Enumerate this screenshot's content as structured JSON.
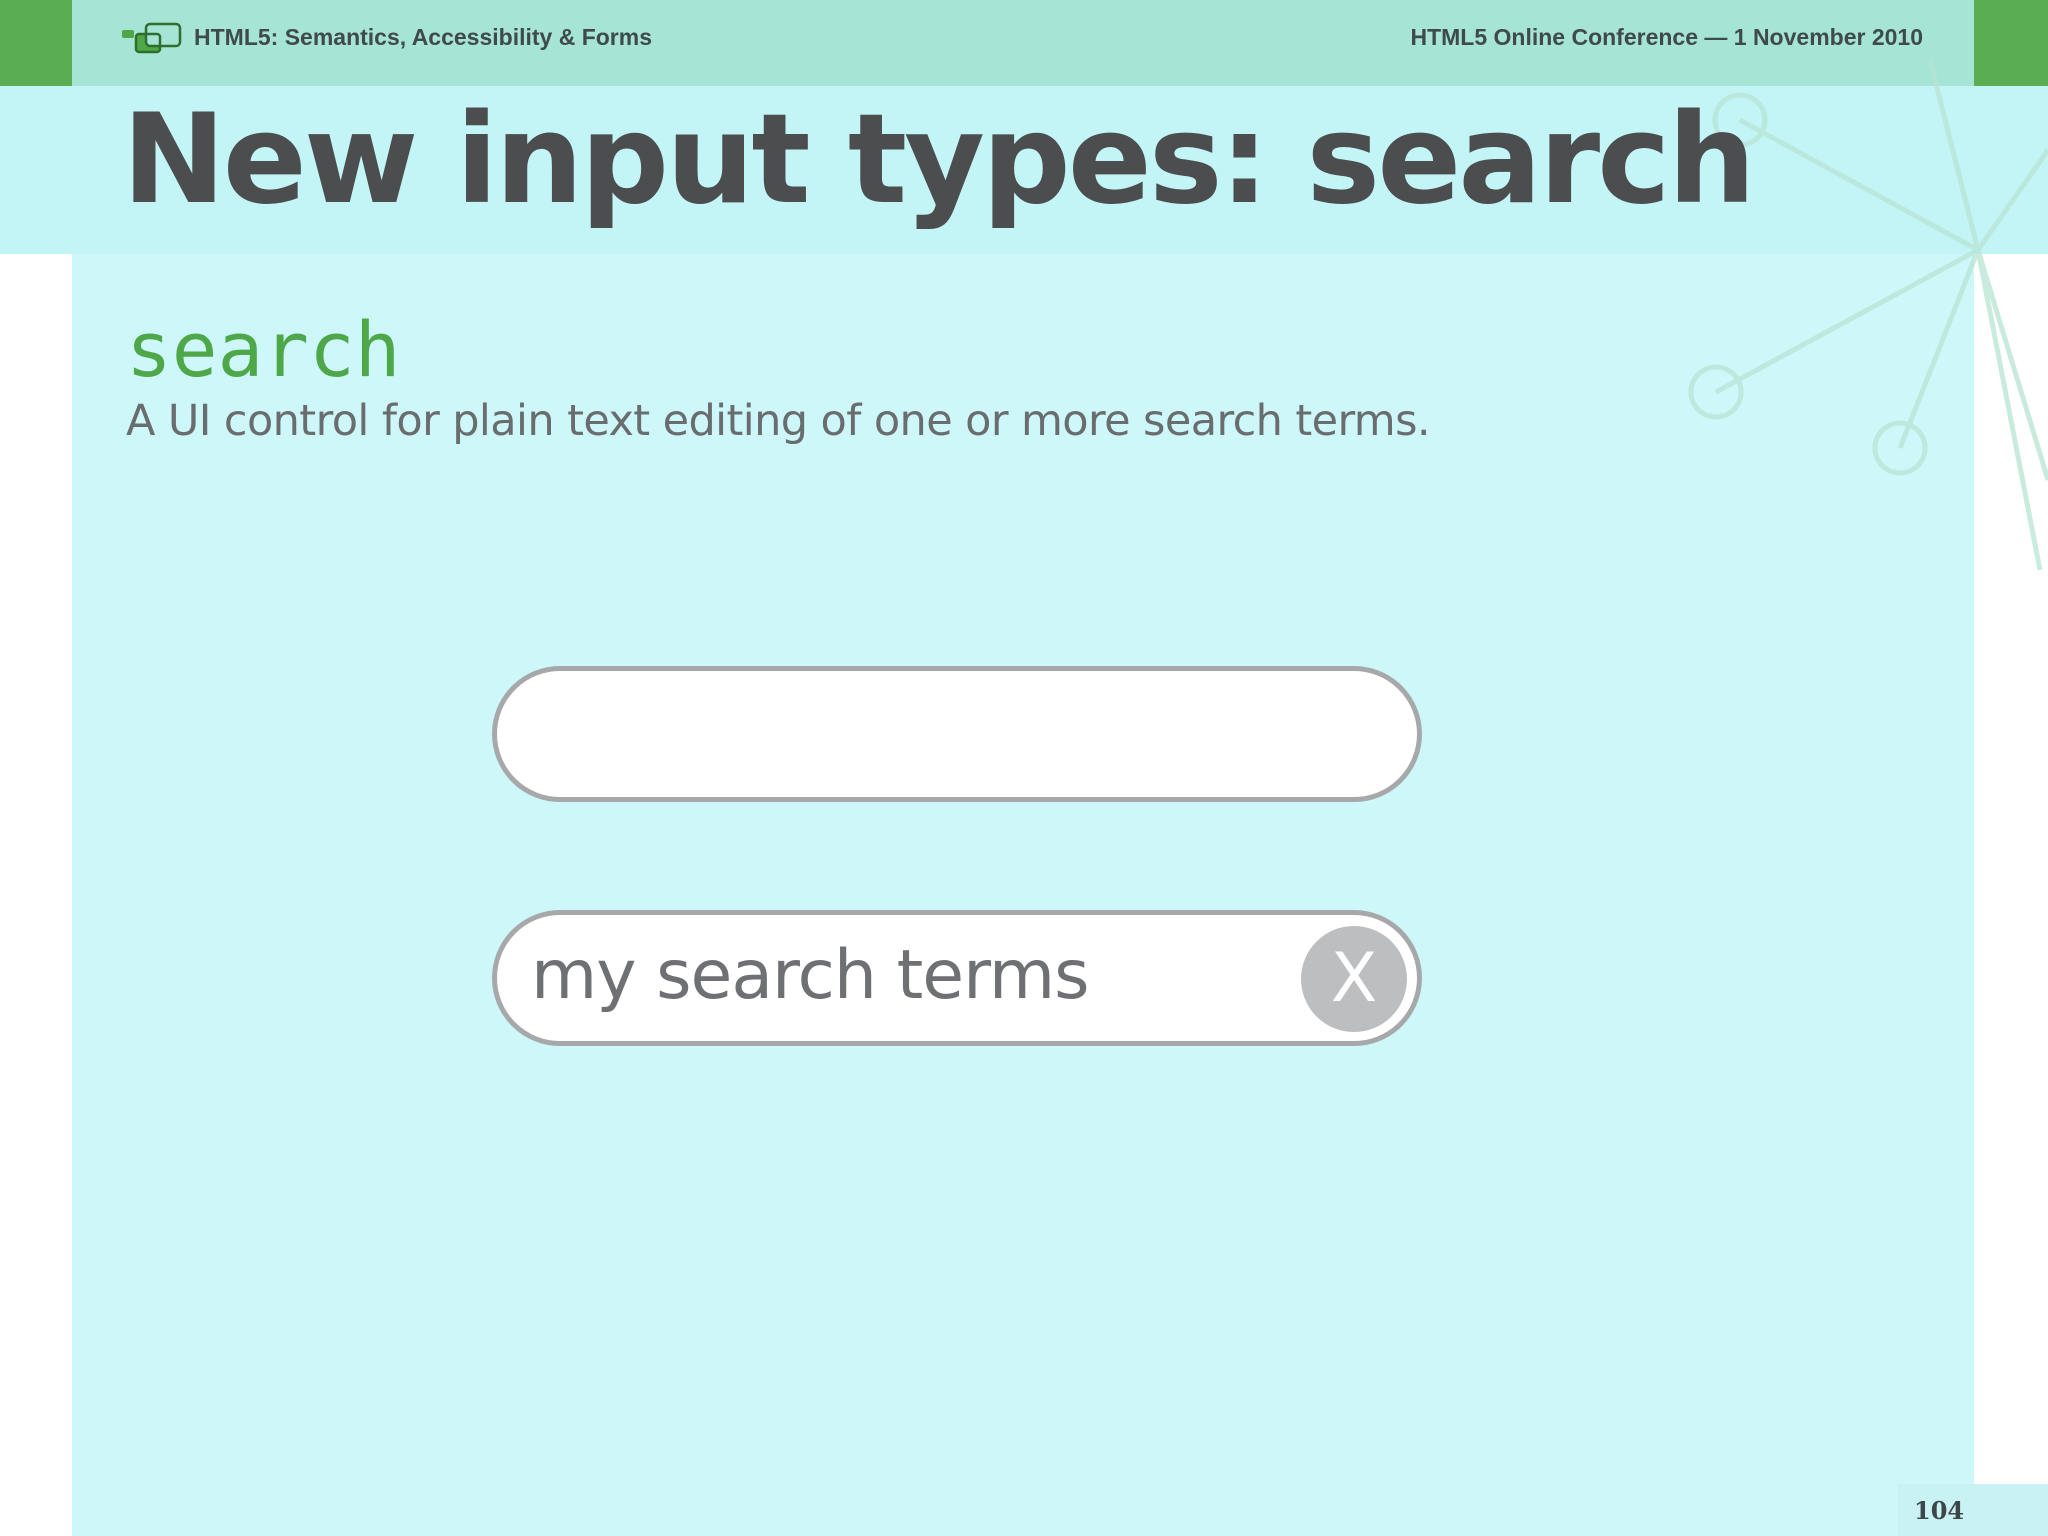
{
  "header": {
    "left_title": "HTML5: Semantics, Accessibility & Forms",
    "right_title": "HTML5 Online Conference — 1 November 2010"
  },
  "slide": {
    "title": "New input types: search",
    "term": "search",
    "description": "A UI control for plain text editing of one or more search terms."
  },
  "examples": {
    "empty_search": {
      "value": ""
    },
    "filled_search": {
      "value": "my search terms",
      "clear_label": "X"
    }
  },
  "footer": {
    "page_number": "104"
  },
  "colors": {
    "brand_green": "#5aad52",
    "header_mint": "#a6e4d6",
    "slide_background": "#cef7f9",
    "title_gray": "#4b4d4f",
    "term_green": "#4ea84a"
  },
  "icons": {
    "logo": "overlapping-windows-logo-icon",
    "clear": "clear-x-icon"
  }
}
